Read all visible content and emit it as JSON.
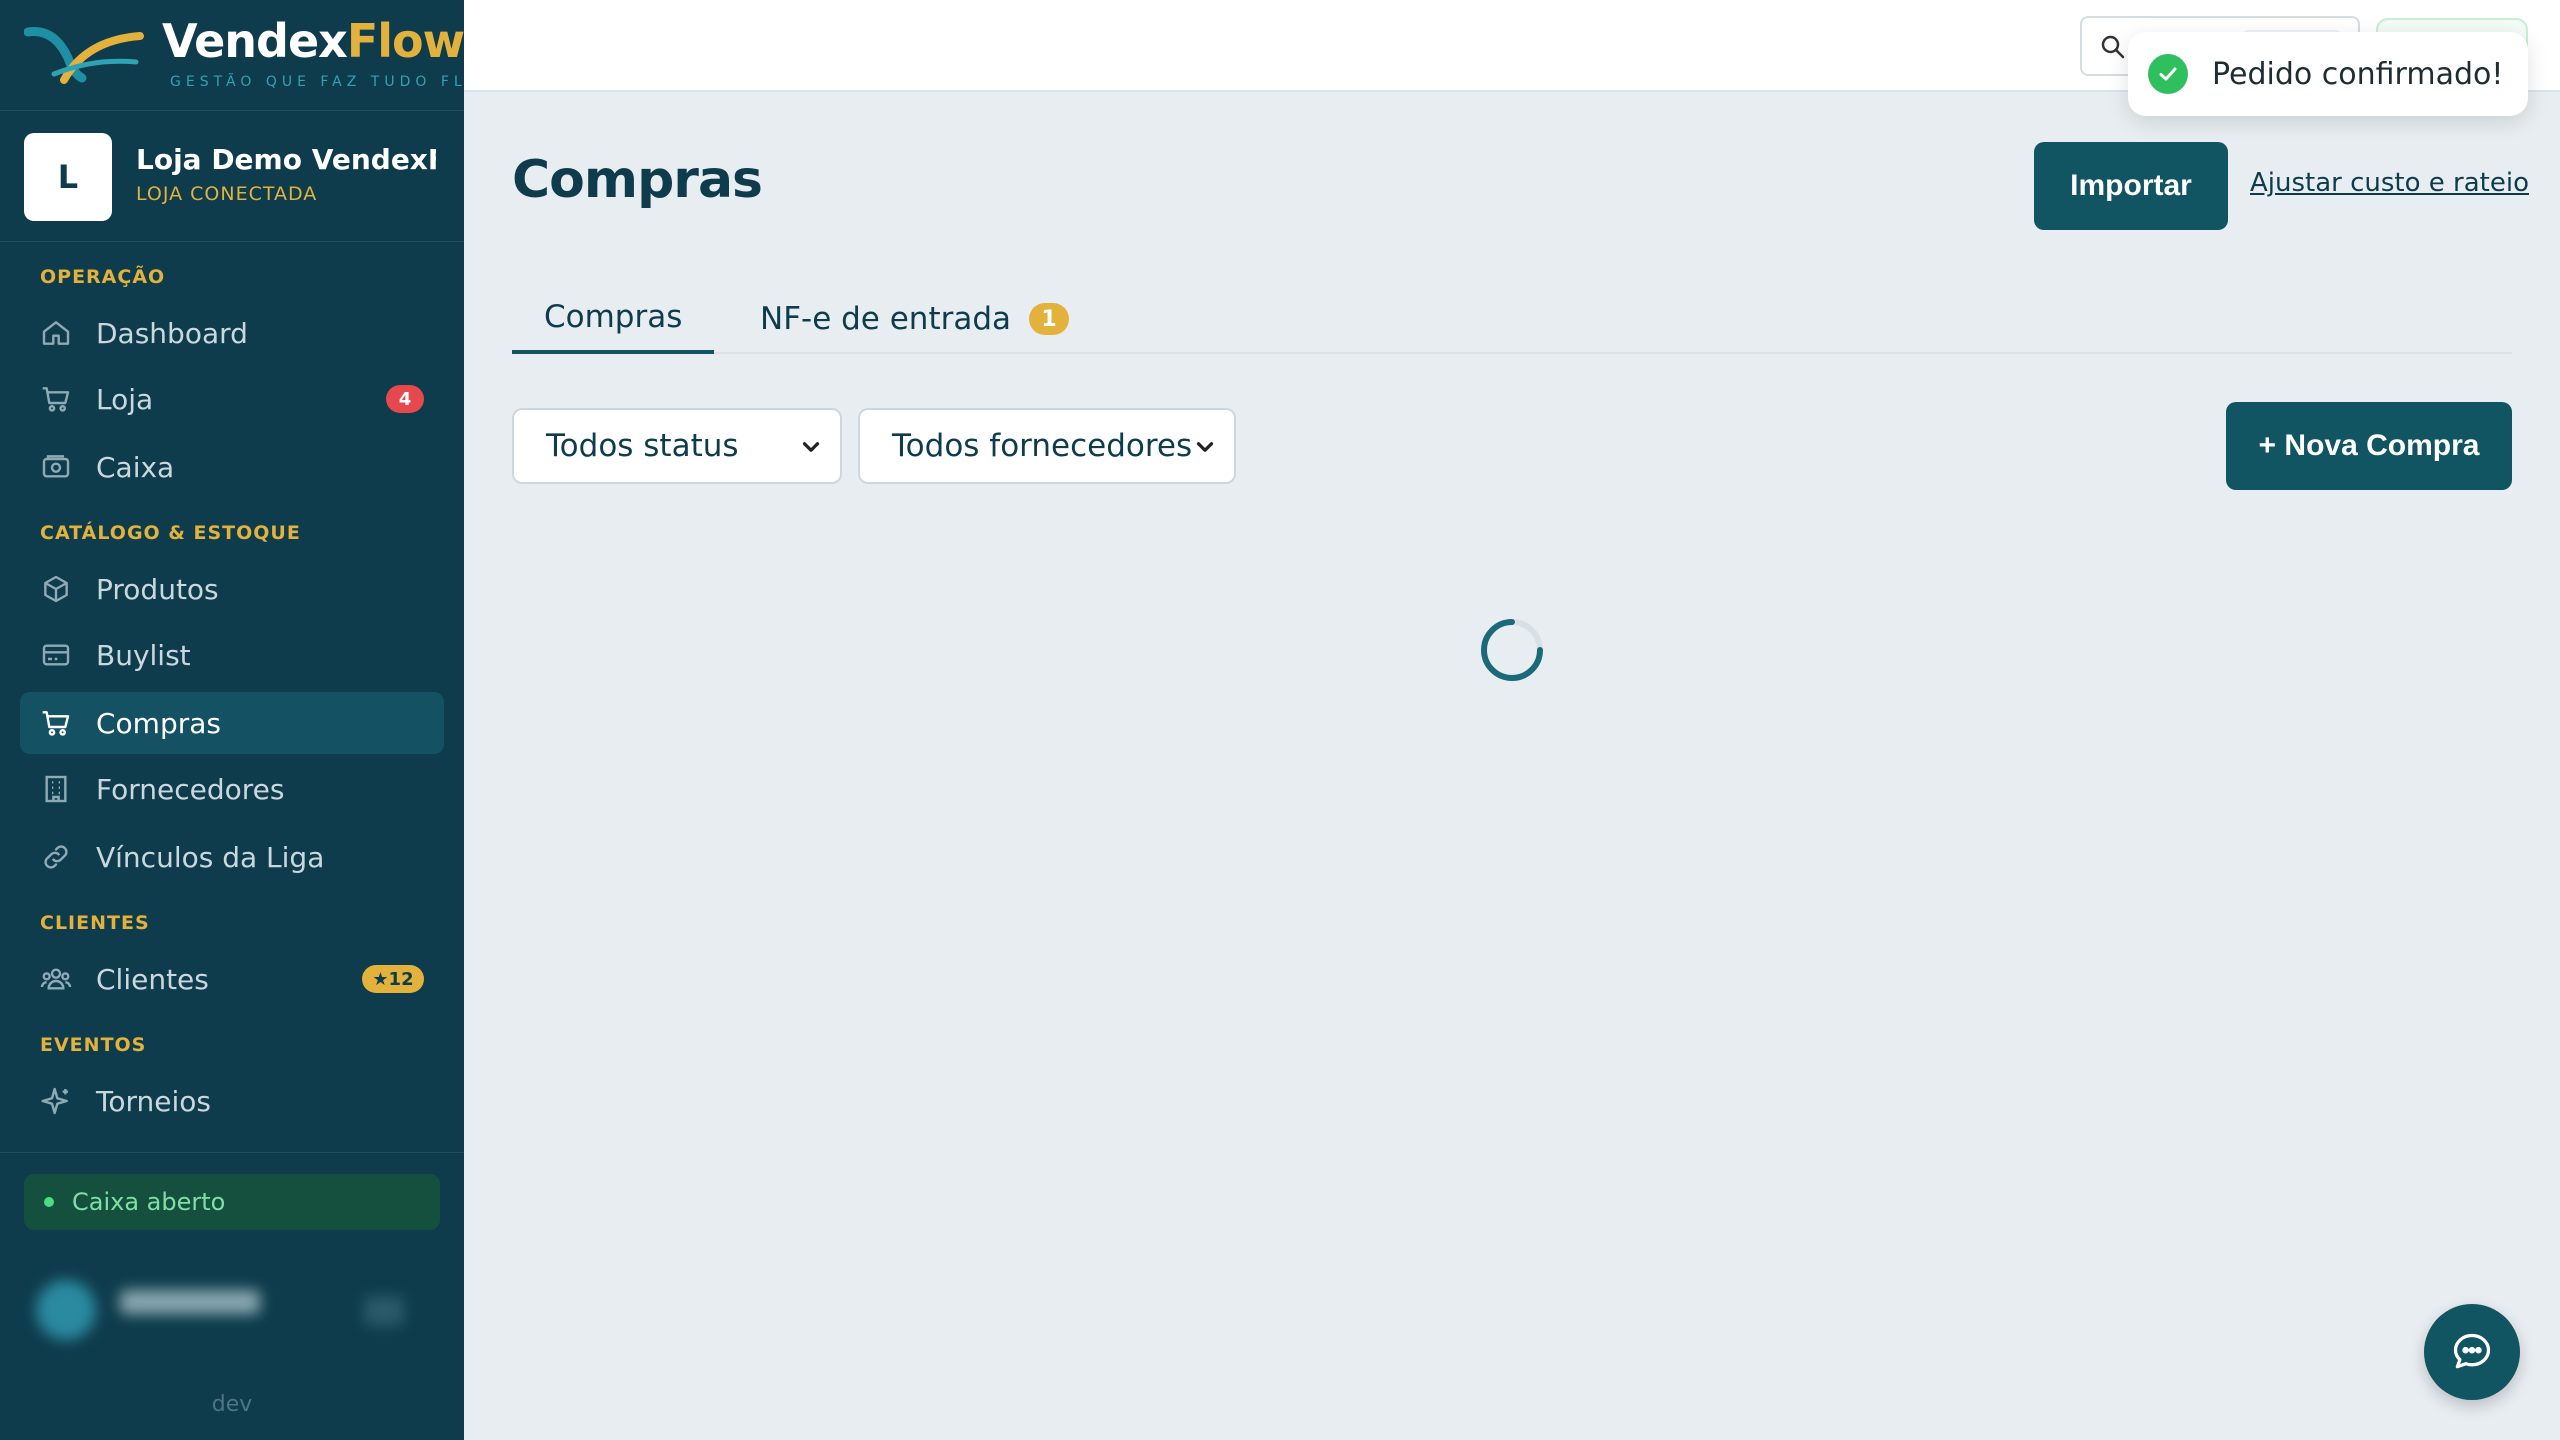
{
  "brand": {
    "name_part1": "Vendex",
    "name_part2": "Flow",
    "tagline": "GESTÃO QUE FAZ TUDO FLUIR"
  },
  "store": {
    "avatar_letter": "L",
    "name": "Loja Demo VendexFl...",
    "status": "LOJA CONECTADA"
  },
  "sidebar": {
    "sections": [
      {
        "label": "OPERAÇÃO"
      },
      {
        "label": "CATÁLOGO & ESTOQUE"
      },
      {
        "label": "CLIENTES"
      },
      {
        "label": "EVENTOS"
      }
    ],
    "items": [
      {
        "label": "Dashboard",
        "icon": "home-icon"
      },
      {
        "label": "Loja",
        "icon": "cart-icon",
        "badge": "4"
      },
      {
        "label": "Caixa",
        "icon": "cash-register-icon"
      },
      {
        "label": "Produtos",
        "icon": "box-icon"
      },
      {
        "label": "Buylist",
        "icon": "card-icon"
      },
      {
        "label": "Compras",
        "icon": "cart-icon",
        "active": true
      },
      {
        "label": "Fornecedores",
        "icon": "building-icon"
      },
      {
        "label": "Vínculos da Liga",
        "icon": "link-icon"
      },
      {
        "label": "Clientes",
        "icon": "users-icon",
        "badge": "★12"
      },
      {
        "label": "Torneios",
        "icon": "sparkle-icon"
      }
    ],
    "cash_status": "Caixa aberto",
    "env": "dev"
  },
  "toast": {
    "message": "Pedido confirmado!"
  },
  "page": {
    "title": "Compras",
    "import_label": "Importar",
    "adjust_link": "Ajustar custo e rateio",
    "tabs": [
      {
        "label": "Compras",
        "active": true
      },
      {
        "label": "NF-e de entrada",
        "badge": "1"
      }
    ],
    "filters": {
      "status": "Todos status",
      "supplier": "Todos fornecedores"
    },
    "new_purchase_label": "+ Nova Compra"
  },
  "colors": {
    "sidebar_bg": "#0e3c4c",
    "accent": "#115563",
    "gold": "#e3b23c",
    "success": "#2fbf5f"
  }
}
